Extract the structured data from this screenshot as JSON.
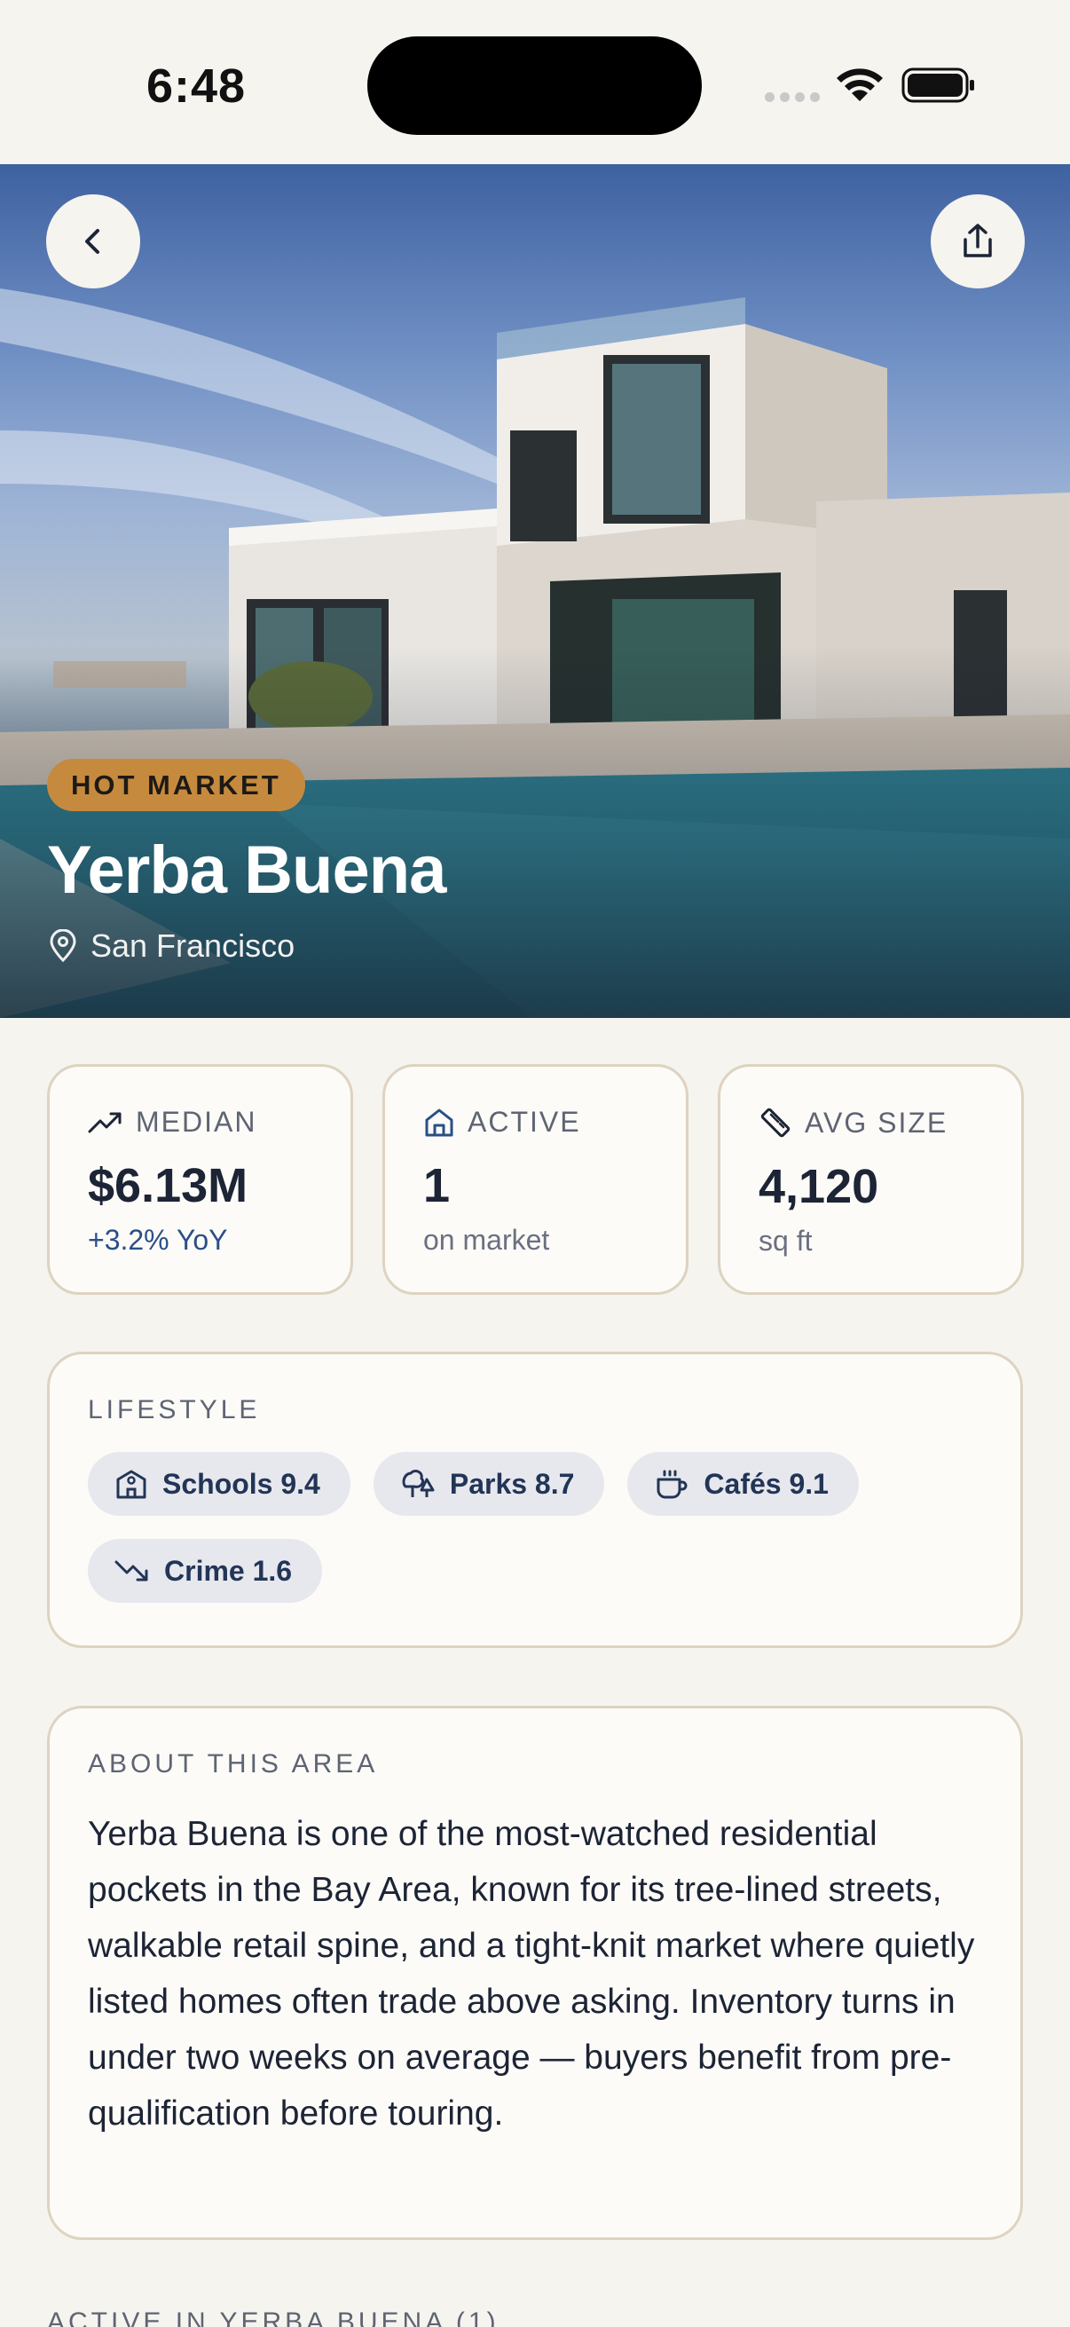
{
  "status_bar": {
    "time": "6:48"
  },
  "hero": {
    "badge": "HOT MARKET",
    "title": "Yerba Buena",
    "location": "San Francisco"
  },
  "stats": [
    {
      "icon": "trending-up-icon",
      "label": "MEDIAN",
      "value": "$6.13M",
      "sub": "+3.2% YoY"
    },
    {
      "icon": "home-icon",
      "label": "ACTIVE",
      "value": "1",
      "sub": "on market"
    },
    {
      "icon": "ruler-icon",
      "label": "AVG SIZE",
      "value": "4,120",
      "sub": "sq ft"
    }
  ],
  "lifestyle": {
    "label": "LIFESTYLE",
    "chips": [
      {
        "icon": "school-icon",
        "text": "Schools 9.4"
      },
      {
        "icon": "trees-icon",
        "text": "Parks 8.7"
      },
      {
        "icon": "coffee-icon",
        "text": "Cafés 9.1"
      },
      {
        "icon": "trending-down-icon",
        "text": "Crime 1.6"
      }
    ]
  },
  "about": {
    "label": "ABOUT THIS AREA",
    "text": "Yerba Buena is one of the most-watched residential pockets in the Bay Area, known for its tree-lined streets, walkable retail spine, and a tight-knit market where quietly listed homes often trade above asking. Inventory turns in under two weeks on average — buyers benefit from pre-qualification before touring."
  },
  "listings_section": {
    "label": "ACTIVE IN YERBA BUENA (1)"
  },
  "colors": {
    "accent": "#c68a3e",
    "navy": "#223556",
    "background": "#f6f4ef"
  }
}
